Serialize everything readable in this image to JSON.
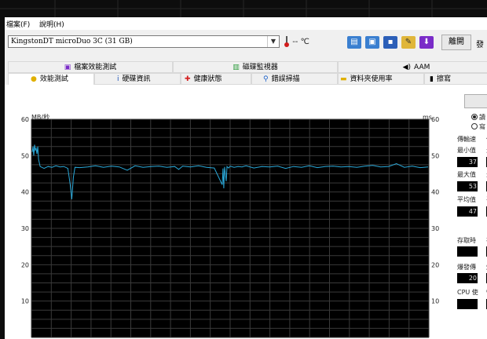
{
  "menu": [
    {
      "label": "檔案(F)"
    },
    {
      "label": "說明(H)"
    }
  ],
  "toolbar": {
    "drive": "KingstonDT microDuo 3C (31 GB)",
    "temperature": "-- ℃",
    "exit_label": "離開",
    "exit_next": "發"
  },
  "tabs_top": [
    {
      "label": "檔案效能測試",
      "icon": "file-benchmark-icon"
    },
    {
      "label": "磁碟監視器",
      "icon": "disk-monitor-icon"
    },
    {
      "label": "AAM",
      "icon": "speaker-icon"
    }
  ],
  "tabs_bottom": [
    {
      "label": "效能測試",
      "icon": "bulb-icon"
    },
    {
      "label": "硬碟資訊",
      "icon": "info-icon"
    },
    {
      "label": "健康狀態",
      "icon": "health-cross-icon"
    },
    {
      "label": "錯誤掃描",
      "icon": "magnifier-icon"
    },
    {
      "label": "資料夾使用率",
      "icon": "folder-icon"
    },
    {
      "label": "擦寫",
      "icon": "eraser-icon"
    }
  ],
  "side": {
    "radio_1": "讀",
    "radio_2": "寫",
    "transfer_header": "傳輸速",
    "transfer_header2": "傳",
    "min_label": "最小值",
    "min_label2": "最",
    "min_value": "37",
    "max_label": "最大值",
    "max_label2": "最",
    "max_value": "53",
    "avg_label": "平均值",
    "avg_label2": "平",
    "avg_value": "47",
    "access_label": "存取時",
    "access_label2": "存",
    "burst_label": "爆發傳",
    "burst_label2": "爆",
    "burst_value": "20",
    "cpu_label": "CPU 使",
    "cpu_label2": "C"
  },
  "chart_data": {
    "type": "line",
    "ylabel_left": "MB/秒",
    "ylabel_right": "ms",
    "ylim": [
      0,
      60
    ],
    "yticks": [
      10,
      20,
      30,
      40,
      50,
      60
    ],
    "grid": true,
    "series": [
      {
        "color": "#2aa8d8",
        "x": [
          0,
          1,
          2,
          3,
          4,
          5,
          6,
          7,
          8,
          10,
          15,
          20,
          25,
          30,
          35,
          40,
          45,
          48,
          50,
          52,
          54,
          60,
          70,
          80,
          90,
          100,
          110,
          120,
          130,
          140,
          150,
          160,
          170,
          180,
          185,
          190,
          200,
          210,
          220,
          230,
          240,
          241,
          242,
          243,
          245,
          246,
          248,
          250,
          255,
          260,
          265,
          270,
          280,
          290,
          300,
          310,
          320,
          330,
          340,
          350,
          360,
          370,
          380,
          390,
          400,
          410,
          420,
          430,
          440,
          450,
          460,
          470,
          480,
          490,
          500
        ],
        "y": [
          51,
          52.5,
          50,
          53,
          51.5,
          52,
          50.5,
          52.5,
          49,
          47,
          46.5,
          47,
          46.8,
          47.2,
          46.9,
          47,
          46.5,
          42,
          38,
          44,
          46.8,
          46.7,
          46.9,
          47.2,
          46.8,
          47.1,
          46.9,
          46,
          47.2,
          46.8,
          47,
          47.1,
          46.8,
          47,
          46.2,
          47.1,
          46.9,
          47.2,
          46.8,
          46.6,
          42,
          46.5,
          41,
          46.9,
          43,
          47,
          46.6,
          47.1,
          46.8,
          47,
          46.9,
          47.2,
          46.6,
          47,
          46.9,
          47.1,
          46.5,
          47,
          46.8,
          47.2,
          46.7,
          47,
          47.1,
          46.9,
          47,
          46.8,
          47.1,
          47.3,
          46.9,
          47,
          47.8,
          46.8,
          47.1,
          46.7,
          46.9
        ]
      }
    ]
  }
}
